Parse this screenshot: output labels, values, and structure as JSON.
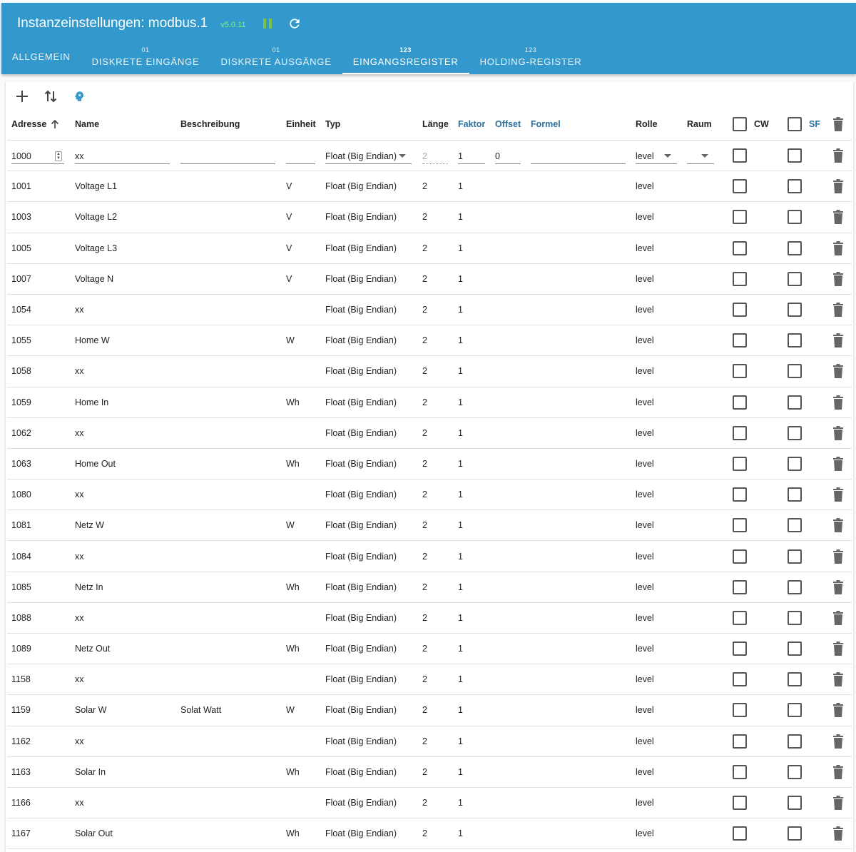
{
  "header": {
    "title": "Instanzeinstellungen: modbus.1",
    "version": "v5.0.11"
  },
  "tabs": [
    {
      "icon_text": "",
      "label": "ALLGEMEIN",
      "active": false
    },
    {
      "icon_text": "01",
      "label": "DISKRETE EINGÄNGE",
      "active": false
    },
    {
      "icon_text": "01",
      "label": "DISKRETE AUSGÄNGE",
      "active": false
    },
    {
      "icon_text": "123",
      "label": "EINGANGSREGISTER",
      "active": true
    },
    {
      "icon_text": "123",
      "label": "HOLDING-REGISTER",
      "active": false
    }
  ],
  "toolbar": {
    "icons": [
      "add-icon",
      "import-export-icon",
      "ai-head-icon"
    ]
  },
  "columns": {
    "address": "Adresse",
    "name": "Name",
    "description": "Beschreibung",
    "unit": "Einheit",
    "type": "Typ",
    "length": "Länge",
    "factor": "Faktor",
    "offset": "Offset",
    "formula": "Formel",
    "role": "Rolle",
    "room": "Raum",
    "cw": "CW",
    "sf": "SF"
  },
  "edit_row": {
    "address": "1000",
    "name": "xx",
    "description": "",
    "unit": "",
    "type": "Float (Big Endian)",
    "length": "2",
    "factor": "1",
    "offset": "0",
    "formula": "",
    "role": "level",
    "room": ""
  },
  "rows": [
    {
      "address": "1001",
      "name": "Voltage L1",
      "description": "",
      "unit": "V",
      "type": "Float (Big Endian)",
      "length": "2",
      "factor": "1",
      "role": "level"
    },
    {
      "address": "1003",
      "name": "Voltage L2",
      "description": "",
      "unit": "V",
      "type": "Float (Big Endian)",
      "length": "2",
      "factor": "1",
      "role": "level"
    },
    {
      "address": "1005",
      "name": "Voltage L3",
      "description": "",
      "unit": "V",
      "type": "Float (Big Endian)",
      "length": "2",
      "factor": "1",
      "role": "level"
    },
    {
      "address": "1007",
      "name": "Voltage N",
      "description": "",
      "unit": "V",
      "type": "Float (Big Endian)",
      "length": "2",
      "factor": "1",
      "role": "level"
    },
    {
      "address": "1054",
      "name": "xx",
      "description": "",
      "unit": "",
      "type": "Float (Big Endian)",
      "length": "2",
      "factor": "1",
      "role": "level"
    },
    {
      "address": "1055",
      "name": "Home W",
      "description": "",
      "unit": "W",
      "type": "Float (Big Endian)",
      "length": "2",
      "factor": "1",
      "role": "level"
    },
    {
      "address": "1058",
      "name": "xx",
      "description": "",
      "unit": "",
      "type": "Float (Big Endian)",
      "length": "2",
      "factor": "1",
      "role": "level"
    },
    {
      "address": "1059",
      "name": "Home In",
      "description": "",
      "unit": "Wh",
      "type": "Float (Big Endian)",
      "length": "2",
      "factor": "1",
      "role": "level"
    },
    {
      "address": "1062",
      "name": "xx",
      "description": "",
      "unit": "",
      "type": "Float (Big Endian)",
      "length": "2",
      "factor": "1",
      "role": "level"
    },
    {
      "address": "1063",
      "name": "Home Out",
      "description": "",
      "unit": "Wh",
      "type": "Float (Big Endian)",
      "length": "2",
      "factor": "1",
      "role": "level"
    },
    {
      "address": "1080",
      "name": "xx",
      "description": "",
      "unit": "",
      "type": "Float (Big Endian)",
      "length": "2",
      "factor": "1",
      "role": "level"
    },
    {
      "address": "1081",
      "name": "Netz W",
      "description": "",
      "unit": "W",
      "type": "Float (Big Endian)",
      "length": "2",
      "factor": "1",
      "role": "level"
    },
    {
      "address": "1084",
      "name": "xx",
      "description": "",
      "unit": "",
      "type": "Float (Big Endian)",
      "length": "2",
      "factor": "1",
      "role": "level"
    },
    {
      "address": "1085",
      "name": "Netz In",
      "description": "",
      "unit": "Wh",
      "type": "Float (Big Endian)",
      "length": "2",
      "factor": "1",
      "role": "level"
    },
    {
      "address": "1088",
      "name": "xx",
      "description": "",
      "unit": "",
      "type": "Float (Big Endian)",
      "length": "2",
      "factor": "1",
      "role": "level"
    },
    {
      "address": "1089",
      "name": "Netz Out",
      "description": "",
      "unit": "Wh",
      "type": "Float (Big Endian)",
      "length": "2",
      "factor": "1",
      "role": "level"
    },
    {
      "address": "1158",
      "name": "xx",
      "description": "",
      "unit": "",
      "type": "Float (Big Endian)",
      "length": "2",
      "factor": "1",
      "role": "level"
    },
    {
      "address": "1159",
      "name": "Solar W",
      "description": "Solat Watt",
      "unit": "W",
      "type": "Float (Big Endian)",
      "length": "2",
      "factor": "1",
      "role": "level"
    },
    {
      "address": "1162",
      "name": "xx",
      "description": "",
      "unit": "",
      "type": "Float (Big Endian)",
      "length": "2",
      "factor": "1",
      "role": "level"
    },
    {
      "address": "1163",
      "name": "Solar In",
      "description": "",
      "unit": "Wh",
      "type": "Float (Big Endian)",
      "length": "2",
      "factor": "1",
      "role": "level"
    },
    {
      "address": "1166",
      "name": "xx",
      "description": "",
      "unit": "",
      "type": "Float (Big Endian)",
      "length": "2",
      "factor": "1",
      "role": "level"
    },
    {
      "address": "1167",
      "name": "Solar Out",
      "description": "",
      "unit": "Wh",
      "type": "Float (Big Endian)",
      "length": "2",
      "factor": "1",
      "role": "level"
    }
  ],
  "colors": {
    "appbar": "#3399cc",
    "version": "#7df27d",
    "pause_icon": "#7cc242",
    "link_header": "#2a6fa0",
    "ai_icon": "#3399cc"
  }
}
